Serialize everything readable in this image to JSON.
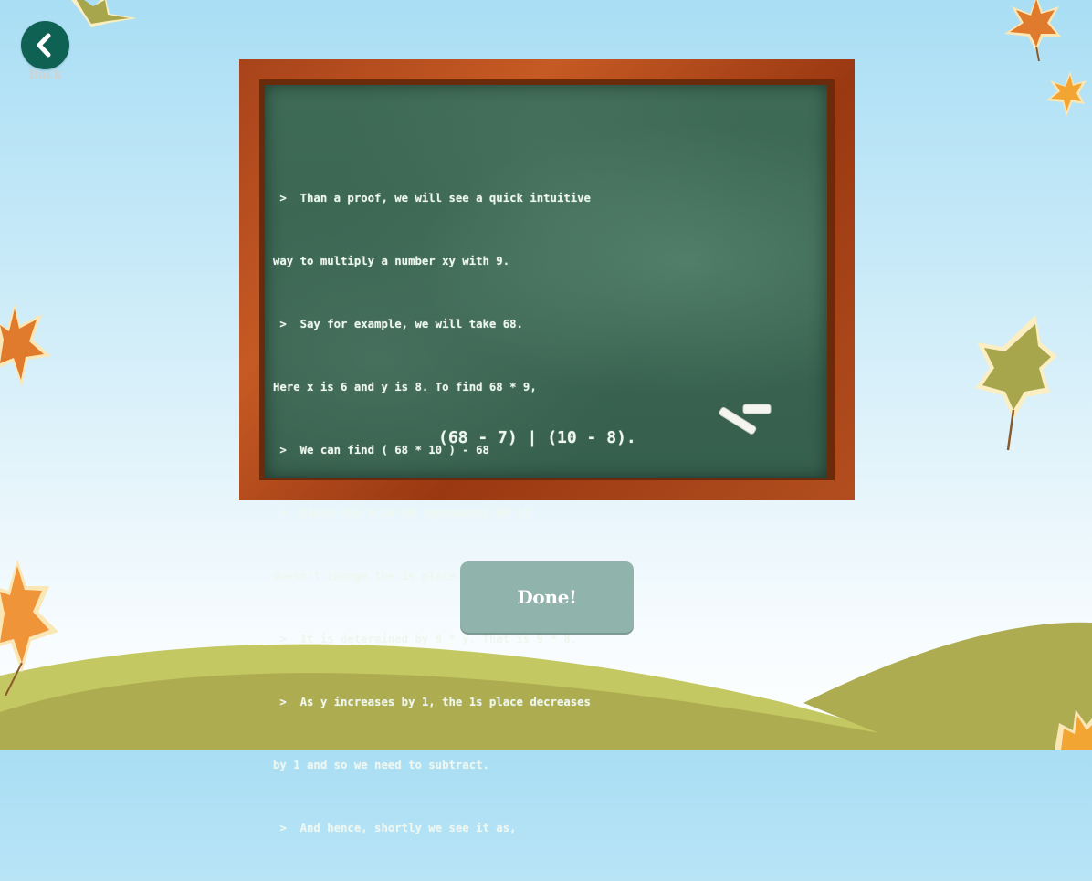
{
  "nav": {
    "back_label": "Back"
  },
  "board": {
    "lines": [
      " >  Than a proof, we will see a quick intuitive",
      "way to multiply a number xy with 9.",
      " >  Say for example, we will take 68.",
      "Here x is 6 and y is 8. To find 68 * 9,",
      " >  We can find ( 68 * 10 ) - 68",
      " >  Since the 6 in 68 represents 60 it",
      "doesn't change the 1s place of the product.",
      " >  It is determined by 9 * y. That is 9 * 8.",
      " >  As y increases by 1, the 1s place decreases",
      "by 1 and so we need to subtract.",
      " >  And hence, shortly we see it as,"
    ],
    "result": "(68 - 7) | (10 - 8)."
  },
  "actions": {
    "done_label": "Done!"
  },
  "icons": {
    "back": "chevron-left-icon",
    "leaves": "autumn-leaf-icon",
    "chalk": "chalk-icon"
  },
  "colors": {
    "back_button": "#0f6153",
    "done_button": "#90b3ab",
    "hill_light": "#c4c862",
    "hill_dark": "#adac50",
    "board_green": "#3a6552",
    "frame_wood": "#b24e1e"
  }
}
